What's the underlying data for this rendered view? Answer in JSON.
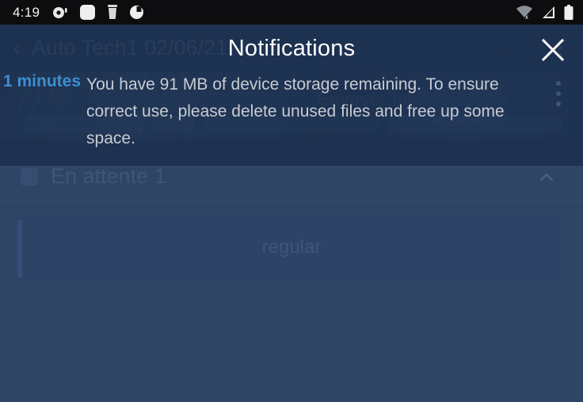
{
  "status_bar": {
    "clock": "4:19",
    "left_icons": [
      "camera-icon",
      "rounded-square-icon",
      "trash-icon",
      "circle-half-icon"
    ],
    "right_icons": [
      "wifi-off-icon",
      "cellular-signal-icon",
      "battery-icon"
    ]
  },
  "notification_overlay": {
    "title": "Notifications",
    "close_label": "×",
    "items": [
      {
        "time": "1 minutes",
        "message": "You have 91 MB of device storage remaining. To ensure correct use, please delete unused files and free up some space.",
        "menu_icon": "kebab-menu-icon"
      }
    ],
    "accent_color": "#3e8ed0",
    "overlay_color": "#172947"
  },
  "background_app": {
    "back_icon": "chevron-left-icon",
    "title": "Auto Tech1 02/06/21",
    "search_placeholder": "",
    "menu_icon": "kebab-menu-icon",
    "banner": {
      "time": "21:34",
      "adjust_label": "Ajuster",
      "send_request_label": "Envoyer une demande",
      "adjust_icon": "vehicle-icon"
    },
    "section": {
      "label": "En attente 1",
      "checkbox_checked": false,
      "collapse_icon": "chevron-up-icon"
    },
    "card": {
      "label": "regular"
    },
    "background_color": "#2f4565"
  }
}
